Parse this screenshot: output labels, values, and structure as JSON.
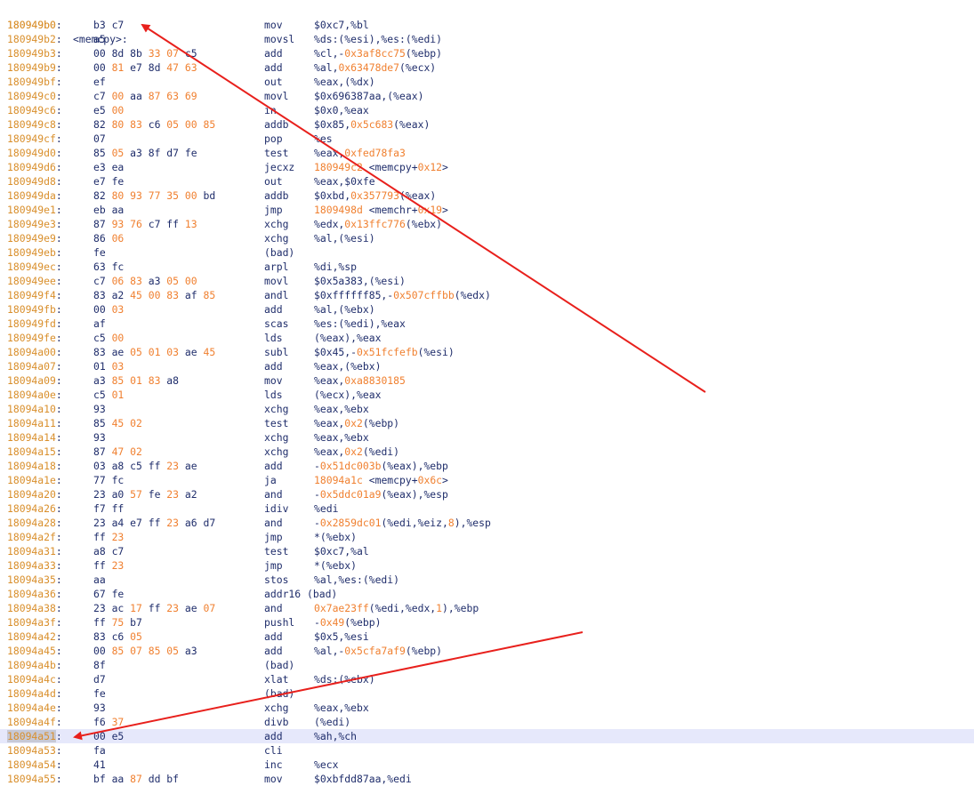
{
  "function_header": {
    "address": "180949b0",
    "label": "<memcpy>:"
  },
  "colors": {
    "address": "#d98f2c",
    "number": "#f08030",
    "text": "#1f2d6b",
    "highlight_row": "#e6e8fb",
    "arrow": "#e8201c"
  },
  "rows": [
    {
      "addr": "180949b0",
      "bytes": "b3 c7",
      "mn": "mov",
      "ops": [
        [
          "$0xc7,%bl",
          "t"
        ]
      ]
    },
    {
      "addr": "180949b2",
      "bytes": "a5",
      "mn": "movsl",
      "ops": [
        [
          "%ds:(%esi),%es:(%edi)",
          "t"
        ]
      ]
    },
    {
      "addr": "180949b3",
      "bytes": "00 8d 8b 33 07 c5",
      "mn": "add",
      "ops": [
        [
          "%cl,-",
          "t"
        ],
        [
          "0x3af8cc75",
          "n"
        ],
        [
          "(%ebp)",
          "t"
        ]
      ]
    },
    {
      "addr": "180949b9",
      "bytes": "00 81 e7 8d 47 63",
      "mn": "add",
      "ops": [
        [
          "%al,",
          "t"
        ],
        [
          "0x63478de7",
          "n"
        ],
        [
          "(%ecx)",
          "t"
        ]
      ]
    },
    {
      "addr": "180949bf",
      "bytes": "ef",
      "mn": "out",
      "ops": [
        [
          "%eax,(%dx)",
          "t"
        ]
      ]
    },
    {
      "addr": "180949c0",
      "bytes": "c7 00 aa 87 63 69",
      "mn": "movl",
      "ops": [
        [
          "$0x696387aa,(%eax)",
          "t"
        ]
      ]
    },
    {
      "addr": "180949c6",
      "bytes": "e5 00",
      "mn": "in",
      "ops": [
        [
          "$0x0,%eax",
          "t"
        ]
      ]
    },
    {
      "addr": "180949c8",
      "bytes": "82 80 83 c6 05 00 85",
      "mn": "addb",
      "ops": [
        [
          "$0x85,",
          "t"
        ],
        [
          "0x5c683",
          "n"
        ],
        [
          "(%eax)",
          "t"
        ]
      ]
    },
    {
      "addr": "180949cf",
      "bytes": "07",
      "mn": "pop",
      "ops": [
        [
          "%es",
          "t"
        ]
      ]
    },
    {
      "addr": "180949d0",
      "bytes": "85 05 a3 8f d7 fe",
      "mn": "test",
      "ops": [
        [
          "%eax,",
          "t"
        ],
        [
          "0xfed78fa3",
          "n"
        ]
      ]
    },
    {
      "addr": "180949d6",
      "bytes": "e3 ea",
      "mn": "jecxz",
      "ops": [
        [
          "180949c2",
          "n"
        ],
        [
          " <memcpy+",
          "t"
        ],
        [
          "0x12",
          "n"
        ],
        [
          ">",
          "t"
        ]
      ]
    },
    {
      "addr": "180949d8",
      "bytes": "e7 fe",
      "mn": "out",
      "ops": [
        [
          "%eax,$0xfe",
          "t"
        ]
      ]
    },
    {
      "addr": "180949da",
      "bytes": "82 80 93 77 35 00 bd",
      "mn": "addb",
      "ops": [
        [
          "$0xbd,",
          "t"
        ],
        [
          "0x357793",
          "n"
        ],
        [
          "(%eax)",
          "t"
        ]
      ]
    },
    {
      "addr": "180949e1",
      "bytes": "eb aa",
      "mn": "jmp",
      "ops": [
        [
          "1809498d",
          "n"
        ],
        [
          " <memchr+",
          "t"
        ],
        [
          "0x19",
          "n"
        ],
        [
          ">",
          "t"
        ]
      ]
    },
    {
      "addr": "180949e3",
      "bytes": "87 93 76 c7 ff 13",
      "mn": "xchg",
      "ops": [
        [
          "%edx,",
          "t"
        ],
        [
          "0x13ffc776",
          "n"
        ],
        [
          "(%ebx)",
          "t"
        ]
      ]
    },
    {
      "addr": "180949e9",
      "bytes": "86 06",
      "mn": "xchg",
      "ops": [
        [
          "%al,(%esi)",
          "t"
        ]
      ]
    },
    {
      "addr": "180949eb",
      "bytes": "fe",
      "mn": "(bad)",
      "ops": []
    },
    {
      "addr": "180949ec",
      "bytes": "63 fc",
      "mn": "arpl",
      "ops": [
        [
          "%di,%sp",
          "t"
        ]
      ]
    },
    {
      "addr": "180949ee",
      "bytes": "c7 06 83 a3 05 00",
      "mn": "movl",
      "ops": [
        [
          "$0x5a383,(%esi)",
          "t"
        ]
      ]
    },
    {
      "addr": "180949f4",
      "bytes": "83 a2 45 00 83 af 85",
      "mn": "andl",
      "ops": [
        [
          "$0xffffff85,-",
          "t"
        ],
        [
          "0x507cffbb",
          "n"
        ],
        [
          "(%edx)",
          "t"
        ]
      ]
    },
    {
      "addr": "180949fb",
      "bytes": "00 03",
      "mn": "add",
      "ops": [
        [
          "%al,(%ebx)",
          "t"
        ]
      ]
    },
    {
      "addr": "180949fd",
      "bytes": "af",
      "mn": "scas",
      "ops": [
        [
          "%es:(%edi),%eax",
          "t"
        ]
      ]
    },
    {
      "addr": "180949fe",
      "bytes": "c5 00",
      "mn": "lds",
      "ops": [
        [
          "(%eax),%eax",
          "t"
        ]
      ]
    },
    {
      "addr": "18094a00",
      "bytes": "83 ae 05 01 03 ae 45",
      "mn": "subl",
      "ops": [
        [
          "$0x45,-",
          "t"
        ],
        [
          "0x51fcfefb",
          "n"
        ],
        [
          "(%esi)",
          "t"
        ]
      ]
    },
    {
      "addr": "18094a07",
      "bytes": "01 03",
      "mn": "add",
      "ops": [
        [
          "%eax,(%ebx)",
          "t"
        ]
      ]
    },
    {
      "addr": "18094a09",
      "bytes": "a3 85 01 83 a8",
      "mn": "mov",
      "ops": [
        [
          "%eax,",
          "t"
        ],
        [
          "0xa8830185",
          "n"
        ]
      ]
    },
    {
      "addr": "18094a0e",
      "bytes": "c5 01",
      "mn": "lds",
      "ops": [
        [
          "(%ecx),%eax",
          "t"
        ]
      ]
    },
    {
      "addr": "18094a10",
      "bytes": "93",
      "mn": "xchg",
      "ops": [
        [
          "%eax,%ebx",
          "t"
        ]
      ]
    },
    {
      "addr": "18094a11",
      "bytes": "85 45 02",
      "mn": "test",
      "ops": [
        [
          "%eax,",
          "t"
        ],
        [
          "0x2",
          "n"
        ],
        [
          "(%ebp)",
          "t"
        ]
      ]
    },
    {
      "addr": "18094a14",
      "bytes": "93",
      "mn": "xchg",
      "ops": [
        [
          "%eax,%ebx",
          "t"
        ]
      ]
    },
    {
      "addr": "18094a15",
      "bytes": "87 47 02",
      "mn": "xchg",
      "ops": [
        [
          "%eax,",
          "t"
        ],
        [
          "0x2",
          "n"
        ],
        [
          "(%edi)",
          "t"
        ]
      ]
    },
    {
      "addr": "18094a18",
      "bytes": "03 a8 c5 ff 23 ae",
      "mn": "add",
      "ops": [
        [
          "-",
          "t"
        ],
        [
          "0x51dc003b",
          "n"
        ],
        [
          "(%eax),%ebp",
          "t"
        ]
      ]
    },
    {
      "addr": "18094a1e",
      "bytes": "77 fc",
      "mn": "ja",
      "ops": [
        [
          "18094a1c",
          "n"
        ],
        [
          " <memcpy+",
          "t"
        ],
        [
          "0x6c",
          "n"
        ],
        [
          ">",
          "t"
        ]
      ]
    },
    {
      "addr": "18094a20",
      "bytes": "23 a0 57 fe 23 a2",
      "mn": "and",
      "ops": [
        [
          "-",
          "t"
        ],
        [
          "0x5ddc01a9",
          "n"
        ],
        [
          "(%eax),%esp",
          "t"
        ]
      ]
    },
    {
      "addr": "18094a26",
      "bytes": "f7 ff",
      "mn": "idiv",
      "ops": [
        [
          "%edi",
          "t"
        ]
      ]
    },
    {
      "addr": "18094a28",
      "bytes": "23 a4 e7 ff 23 a6 d7",
      "mn": "and",
      "ops": [
        [
          "-",
          "t"
        ],
        [
          "0x2859dc01",
          "n"
        ],
        [
          "(%edi,%eiz,",
          "t"
        ],
        [
          "8",
          "n"
        ],
        [
          "),%esp",
          "t"
        ]
      ]
    },
    {
      "addr": "18094a2f",
      "bytes": "ff 23",
      "mn": "jmp",
      "ops": [
        [
          "*(%ebx)",
          "t"
        ]
      ]
    },
    {
      "addr": "18094a31",
      "bytes": "a8 c7",
      "mn": "test",
      "ops": [
        [
          "$0xc7,%al",
          "t"
        ]
      ]
    },
    {
      "addr": "18094a33",
      "bytes": "ff 23",
      "mn": "jmp",
      "ops": [
        [
          "*(%ebx)",
          "t"
        ]
      ]
    },
    {
      "addr": "18094a35",
      "bytes": "aa",
      "mn": "stos",
      "ops": [
        [
          "%al,%es:(%edi)",
          "t"
        ]
      ]
    },
    {
      "addr": "18094a36",
      "bytes": "67 fe",
      "mn": "addr16 (bad)",
      "ops": []
    },
    {
      "addr": "18094a38",
      "bytes": "23 ac 17 ff 23 ae 07",
      "mn": "and",
      "ops": [
        [
          "0x7ae23ff",
          "n"
        ],
        [
          "(%edi,%edx,",
          "t"
        ],
        [
          "1",
          "n"
        ],
        [
          "),%ebp",
          "t"
        ]
      ]
    },
    {
      "addr": "18094a3f",
      "bytes": "ff 75 b7",
      "mn": "pushl",
      "ops": [
        [
          "-",
          "t"
        ],
        [
          "0x49",
          "n"
        ],
        [
          "(%ebp)",
          "t"
        ]
      ]
    },
    {
      "addr": "18094a42",
      "bytes": "83 c6 05",
      "mn": "add",
      "ops": [
        [
          "$0x5,%esi",
          "t"
        ]
      ]
    },
    {
      "addr": "18094a45",
      "bytes": "00 85 07 85 05 a3",
      "mn": "add",
      "ops": [
        [
          "%al,-",
          "t"
        ],
        [
          "0x5cfa7af9",
          "n"
        ],
        [
          "(%ebp)",
          "t"
        ]
      ]
    },
    {
      "addr": "18094a4b",
      "bytes": "8f",
      "mn": "(bad)",
      "ops": []
    },
    {
      "addr": "18094a4c",
      "bytes": "d7",
      "mn": "xlat",
      "ops": [
        [
          "%ds:(%ebx)",
          "t"
        ]
      ]
    },
    {
      "addr": "18094a4d",
      "bytes": "fe",
      "mn": "(bad)",
      "ops": []
    },
    {
      "addr": "18094a4e",
      "bytes": "93",
      "mn": "xchg",
      "ops": [
        [
          "%eax,%ebx",
          "t"
        ]
      ]
    },
    {
      "addr": "18094a4f",
      "bytes": "f6 37",
      "mn": "divb",
      "ops": [
        [
          "(%edi)",
          "t"
        ]
      ]
    },
    {
      "addr": "18094a51",
      "bytes": "00 e5",
      "mn": "add",
      "ops": [
        [
          "%ah,%ch",
          "t"
        ]
      ],
      "highlight": true
    },
    {
      "addr": "18094a53",
      "bytes": "fa",
      "mn": "cli",
      "ops": []
    },
    {
      "addr": "18094a54",
      "bytes": "41",
      "mn": "inc",
      "ops": [
        [
          "%ecx",
          "t"
        ]
      ]
    },
    {
      "addr": "18094a55",
      "bytes": "bf aa 87 dd bf",
      "mn": "mov",
      "ops": [
        [
          "$0xbfdd87aa,%edi",
          "t"
        ]
      ]
    }
  ]
}
